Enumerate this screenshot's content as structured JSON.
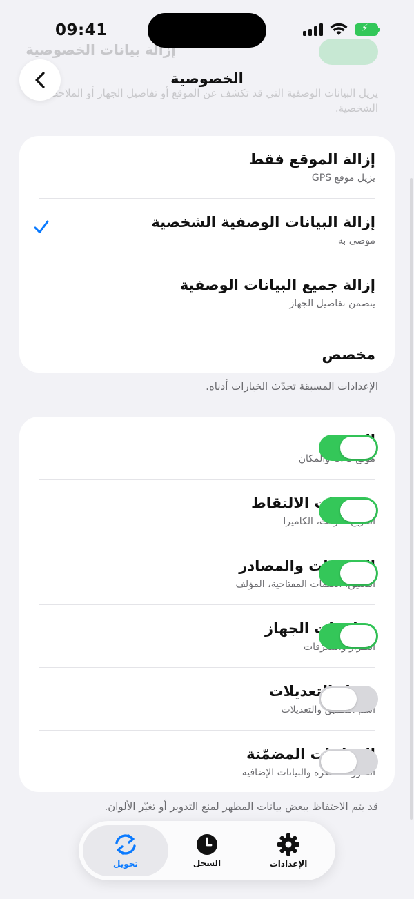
{
  "status": {
    "time": "09:41"
  },
  "ghost": {
    "title": "إزالة بيانات الخصوصية",
    "description": "يزيل البيانات الوصفية التي قد تكشف عن الموقع أو تفاصيل الجهاز أو الملاحظات الشخصية."
  },
  "header": {
    "title": "الخصوصية"
  },
  "presets": [
    {
      "title": "إزالة الموقع فقط",
      "subtitle": "يزيل موقع GPS",
      "selected": false
    },
    {
      "title": "إزالة البيانات الوصفية الشخصية",
      "subtitle": "موصى به",
      "selected": true
    },
    {
      "title": "إزالة جميع البيانات الوصفية",
      "subtitle": "يتضمن تفاصيل الجهاز",
      "selected": false
    },
    {
      "title": "مخصص",
      "subtitle": "",
      "selected": false
    }
  ],
  "presets_footnote": "الإعدادات المسبقة تحدّث الخيارات أدناه.",
  "fields": [
    {
      "title": "الموقع",
      "subtitle": "موقع GPS والمكان",
      "on": true
    },
    {
      "title": "معلومات الالتقاط",
      "subtitle": "التاريخ، الوقت، الكاميرا",
      "on": true
    },
    {
      "title": "التعليقات والمصادر",
      "subtitle": "التعليق، الكلمات المفتاحية، المؤلف",
      "on": true
    },
    {
      "title": "معلومات الجهاز",
      "subtitle": "الطراز والمعرّفات",
      "on": true
    },
    {
      "title": "سجل التعديلات",
      "subtitle": "اسم التطبيق والتعديلات",
      "on": false
    },
    {
      "title": "المعاينات المضمّنة",
      "subtitle": "الصور المصغرة والبيانات الإضافية",
      "on": false
    }
  ],
  "fields_footnote": "قد يتم الاحتفاظ ببعض بيانات المظهر لمنع التدوير أو تغيّر الألوان.",
  "tabs": [
    {
      "label": "الإعدادات",
      "icon": "gear-icon",
      "active": false
    },
    {
      "label": "السجل",
      "icon": "clock-icon",
      "active": false
    },
    {
      "label": "تحويل",
      "icon": "convert-arrows-icon",
      "active": true
    }
  ],
  "colors": {
    "accent": "#0a7aff",
    "toggle_on": "#34c759",
    "toggle_off": "#d8d8dc"
  }
}
